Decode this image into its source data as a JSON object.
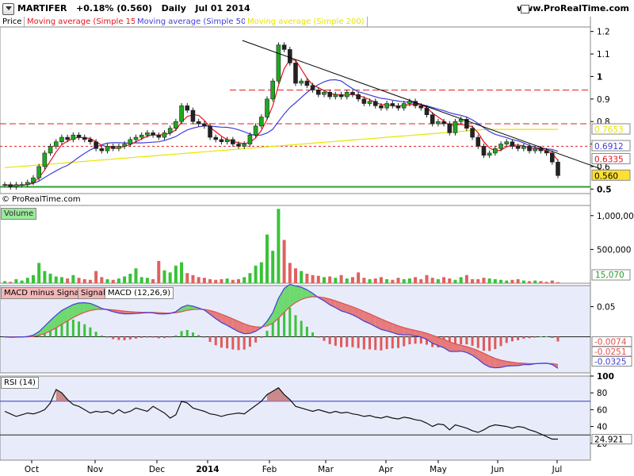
{
  "header": {
    "symbol": "MARTIFER",
    "change": "+0.18% (0.560)",
    "period": "Daily",
    "date": "Jul 01 2014",
    "site": "www.ProRealTime.com"
  },
  "legends": {
    "price": "Price",
    "ma15": "Moving average (Simple 15)",
    "ma50": "Moving average (Simple 50)",
    "ma200": "Moving average (Simple 200)",
    "volume": "Volume",
    "macd_hist": "MACD minus Signal",
    "macd_signal": "Signal",
    "macd": "MACD (12,26,9)",
    "rsi": "RSI (14)"
  },
  "copyright": "© ProRealTime.com",
  "colors": {
    "ma15": "#e8141b",
    "ma50": "#3f3fd9",
    "ma200": "#e6e600",
    "candle_up": "#1fa81f",
    "candle_down": "#222222",
    "volume_up": "#39c239",
    "volume_down": "#e06060",
    "panel_bg": "#e8ecfa",
    "support": "#2ca02c"
  },
  "chart_data": [
    {
      "type": "candlestick",
      "panel": "price",
      "ylim": [
        0.48,
        1.22
      ],
      "y_ticks": [
        0.5,
        0.6,
        0.7,
        0.8,
        0.9,
        1,
        1.1,
        1.2
      ],
      "tick_labels": [
        "0.5",
        "0.6",
        "0.7",
        "0.8",
        "0.9",
        "1",
        "1.1",
        "1.2"
      ],
      "x_labels": [
        "Oct",
        "Nov",
        "Dec",
        "2014",
        "Feb",
        "Mar",
        "Apr",
        "May",
        "Jun",
        "Jul"
      ],
      "close_series": [
        0.52,
        0.51,
        0.52,
        0.52,
        0.53,
        0.55,
        0.6,
        0.66,
        0.69,
        0.71,
        0.73,
        0.72,
        0.74,
        0.73,
        0.72,
        0.71,
        0.68,
        0.67,
        0.69,
        0.68,
        0.69,
        0.7,
        0.72,
        0.73,
        0.74,
        0.75,
        0.74,
        0.73,
        0.75,
        0.77,
        0.8,
        0.87,
        0.85,
        0.8,
        0.79,
        0.78,
        0.73,
        0.72,
        0.71,
        0.72,
        0.7,
        0.69,
        0.7,
        0.74,
        0.78,
        0.82,
        0.9,
        0.98,
        1.14,
        1.12,
        1.06,
        0.97,
        0.98,
        0.96,
        0.94,
        0.92,
        0.93,
        0.91,
        0.92,
        0.91,
        0.93,
        0.92,
        0.9,
        0.88,
        0.89,
        0.87,
        0.86,
        0.88,
        0.87,
        0.86,
        0.88,
        0.89,
        0.87,
        0.86,
        0.83,
        0.79,
        0.8,
        0.79,
        0.75,
        0.8,
        0.81,
        0.77,
        0.73,
        0.69,
        0.65,
        0.66,
        0.68,
        0.7,
        0.71,
        0.69,
        0.68,
        0.69,
        0.67,
        0.68,
        0.67,
        0.66,
        0.62,
        0.56
      ],
      "series": [
        {
          "name": "Moving average (Simple 15)",
          "last": 0.6335
        },
        {
          "name": "Moving average (Simple 50)",
          "last": 0.6912
        },
        {
          "name": "Moving average (Simple 200)",
          "last": 0.7653
        }
      ],
      "price_last": 0.56,
      "value_labels": [
        "0.7653",
        "0.6912",
        "0.6335",
        "0.560"
      ],
      "horizontal_levels": [
        0.94,
        0.79,
        0.69,
        0.51
      ],
      "trendline": {
        "from": {
          "x": "2014-01-20",
          "y": 1.16
        },
        "to": {
          "x": "2014-07-10",
          "y": 0.59
        }
      }
    },
    {
      "type": "bar",
      "panel": "volume",
      "y_ticks": [
        500000,
        1000000
      ],
      "tick_labels": [
        "500,000",
        "1,000,000"
      ],
      "last_value": 15070,
      "last_label": "15,070"
    },
    {
      "type": "line",
      "panel": "macd",
      "y_ticks": [
        0.05
      ],
      "tick_labels": [
        "0.05"
      ],
      "last_values": {
        "macd_minus_signal": -0.0074,
        "macd": -0.0251,
        "signal": -0.0325
      },
      "value_labels": [
        "-0.0074",
        "-0.0251",
        "-0.0325"
      ]
    },
    {
      "type": "line",
      "panel": "rsi",
      "ylim": [
        0,
        100
      ],
      "y_ticks": [
        20,
        40,
        60,
        80,
        100
      ],
      "tick_labels": [
        "20",
        "40",
        "60",
        "80",
        "100"
      ],
      "levels": [
        70,
        30
      ],
      "last_value": 24.921,
      "last_label": "24.921",
      "values": [
        58,
        55,
        52,
        54,
        56,
        55,
        57,
        60,
        68,
        84,
        80,
        72,
        66,
        64,
        60,
        56,
        58,
        57,
        58,
        55,
        60,
        56,
        58,
        62,
        60,
        58,
        64,
        60,
        56,
        50,
        54,
        70,
        68,
        62,
        60,
        58,
        55,
        54,
        52,
        54,
        55,
        56,
        55,
        60,
        65,
        70,
        78,
        82,
        86,
        78,
        72,
        64,
        62,
        60,
        58,
        60,
        58,
        56,
        58,
        56,
        57,
        55,
        54,
        52,
        53,
        51,
        50,
        52,
        50,
        49,
        51,
        50,
        48,
        47,
        44,
        40,
        43,
        42,
        36,
        42,
        40,
        38,
        35,
        33,
        36,
        40,
        42,
        41,
        40,
        38,
        40,
        39,
        36,
        34,
        31,
        28,
        25,
        25
      ]
    }
  ]
}
